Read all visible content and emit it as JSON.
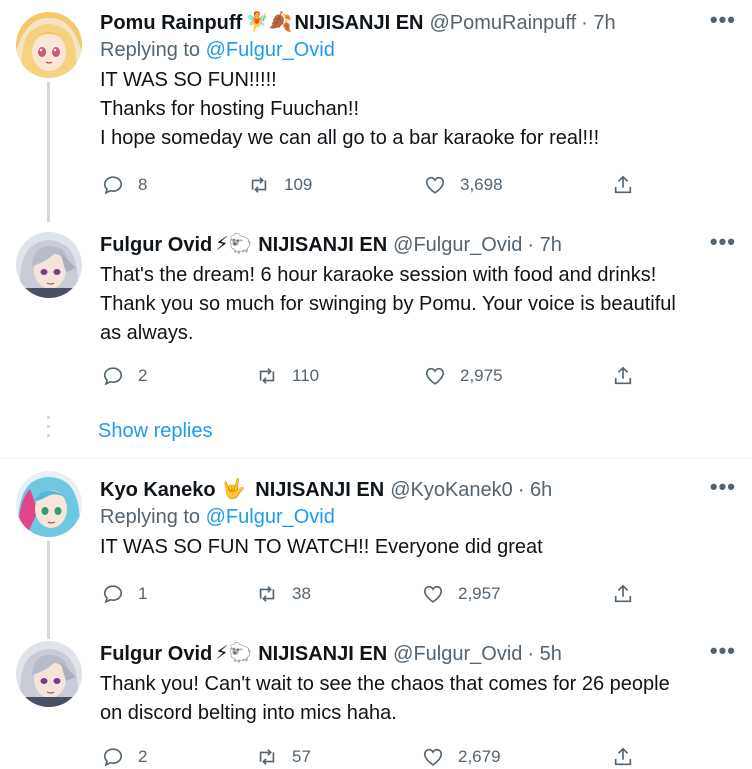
{
  "colors": {
    "accent": "#1d9bf0",
    "muted": "#536471",
    "text": "#0f1419",
    "line": "#cfd9de"
  },
  "tweets": [
    {
      "name": "Pomu Rainpuff",
      "name_emojis": "🧚🍂",
      "org": "NIJISANJI EN",
      "handle": "@PomuRainpuff",
      "time": "· 7h",
      "more": "•••",
      "reply_prefix": "Replying to ",
      "reply_to": "@Fulgur_Ovid",
      "text": "IT WAS SO FUN!!!!!\nThanks for hosting Fuuchan!!\nI hope someday we can all go to a bar karaoke for real!!!",
      "replies": "8",
      "retweets": "109",
      "likes": "3,698"
    },
    {
      "name": "Fulgur Ovid",
      "name_emojis": "⚡🐑",
      "org": "NIJISANJI EN",
      "handle": "@Fulgur_Ovid",
      "time": "· 7h",
      "more": "•••",
      "text": "That's the dream! 6 hour karaoke session with food and drinks!\nThank you so much for swinging by Pomu. Your voice is beautiful\nas always.",
      "replies": "2",
      "retweets": "110",
      "likes": "2,975"
    },
    {
      "name": "Kyo Kaneko",
      "name_emojis": "🤟",
      "org": "NIJISANJI EN",
      "handle": "@KyoKanek0",
      "time": "· 6h",
      "more": "•••",
      "reply_prefix": "Replying to ",
      "reply_to": "@Fulgur_Ovid",
      "text": "IT WAS SO FUN TO WATCH!! Everyone did great",
      "replies": "1",
      "retweets": "38",
      "likes": "2,957"
    },
    {
      "name": "Fulgur Ovid",
      "name_emojis": "⚡🐑",
      "org": "NIJISANJI EN",
      "handle": "@Fulgur_Ovid",
      "time": "· 5h",
      "more": "•••",
      "text": "Thank you! Can't wait to see the chaos that comes for 26 people\non discord belting into mics haha.",
      "replies": "2",
      "retweets": "57",
      "likes": "2,679"
    }
  ],
  "show_replies": "Show replies"
}
